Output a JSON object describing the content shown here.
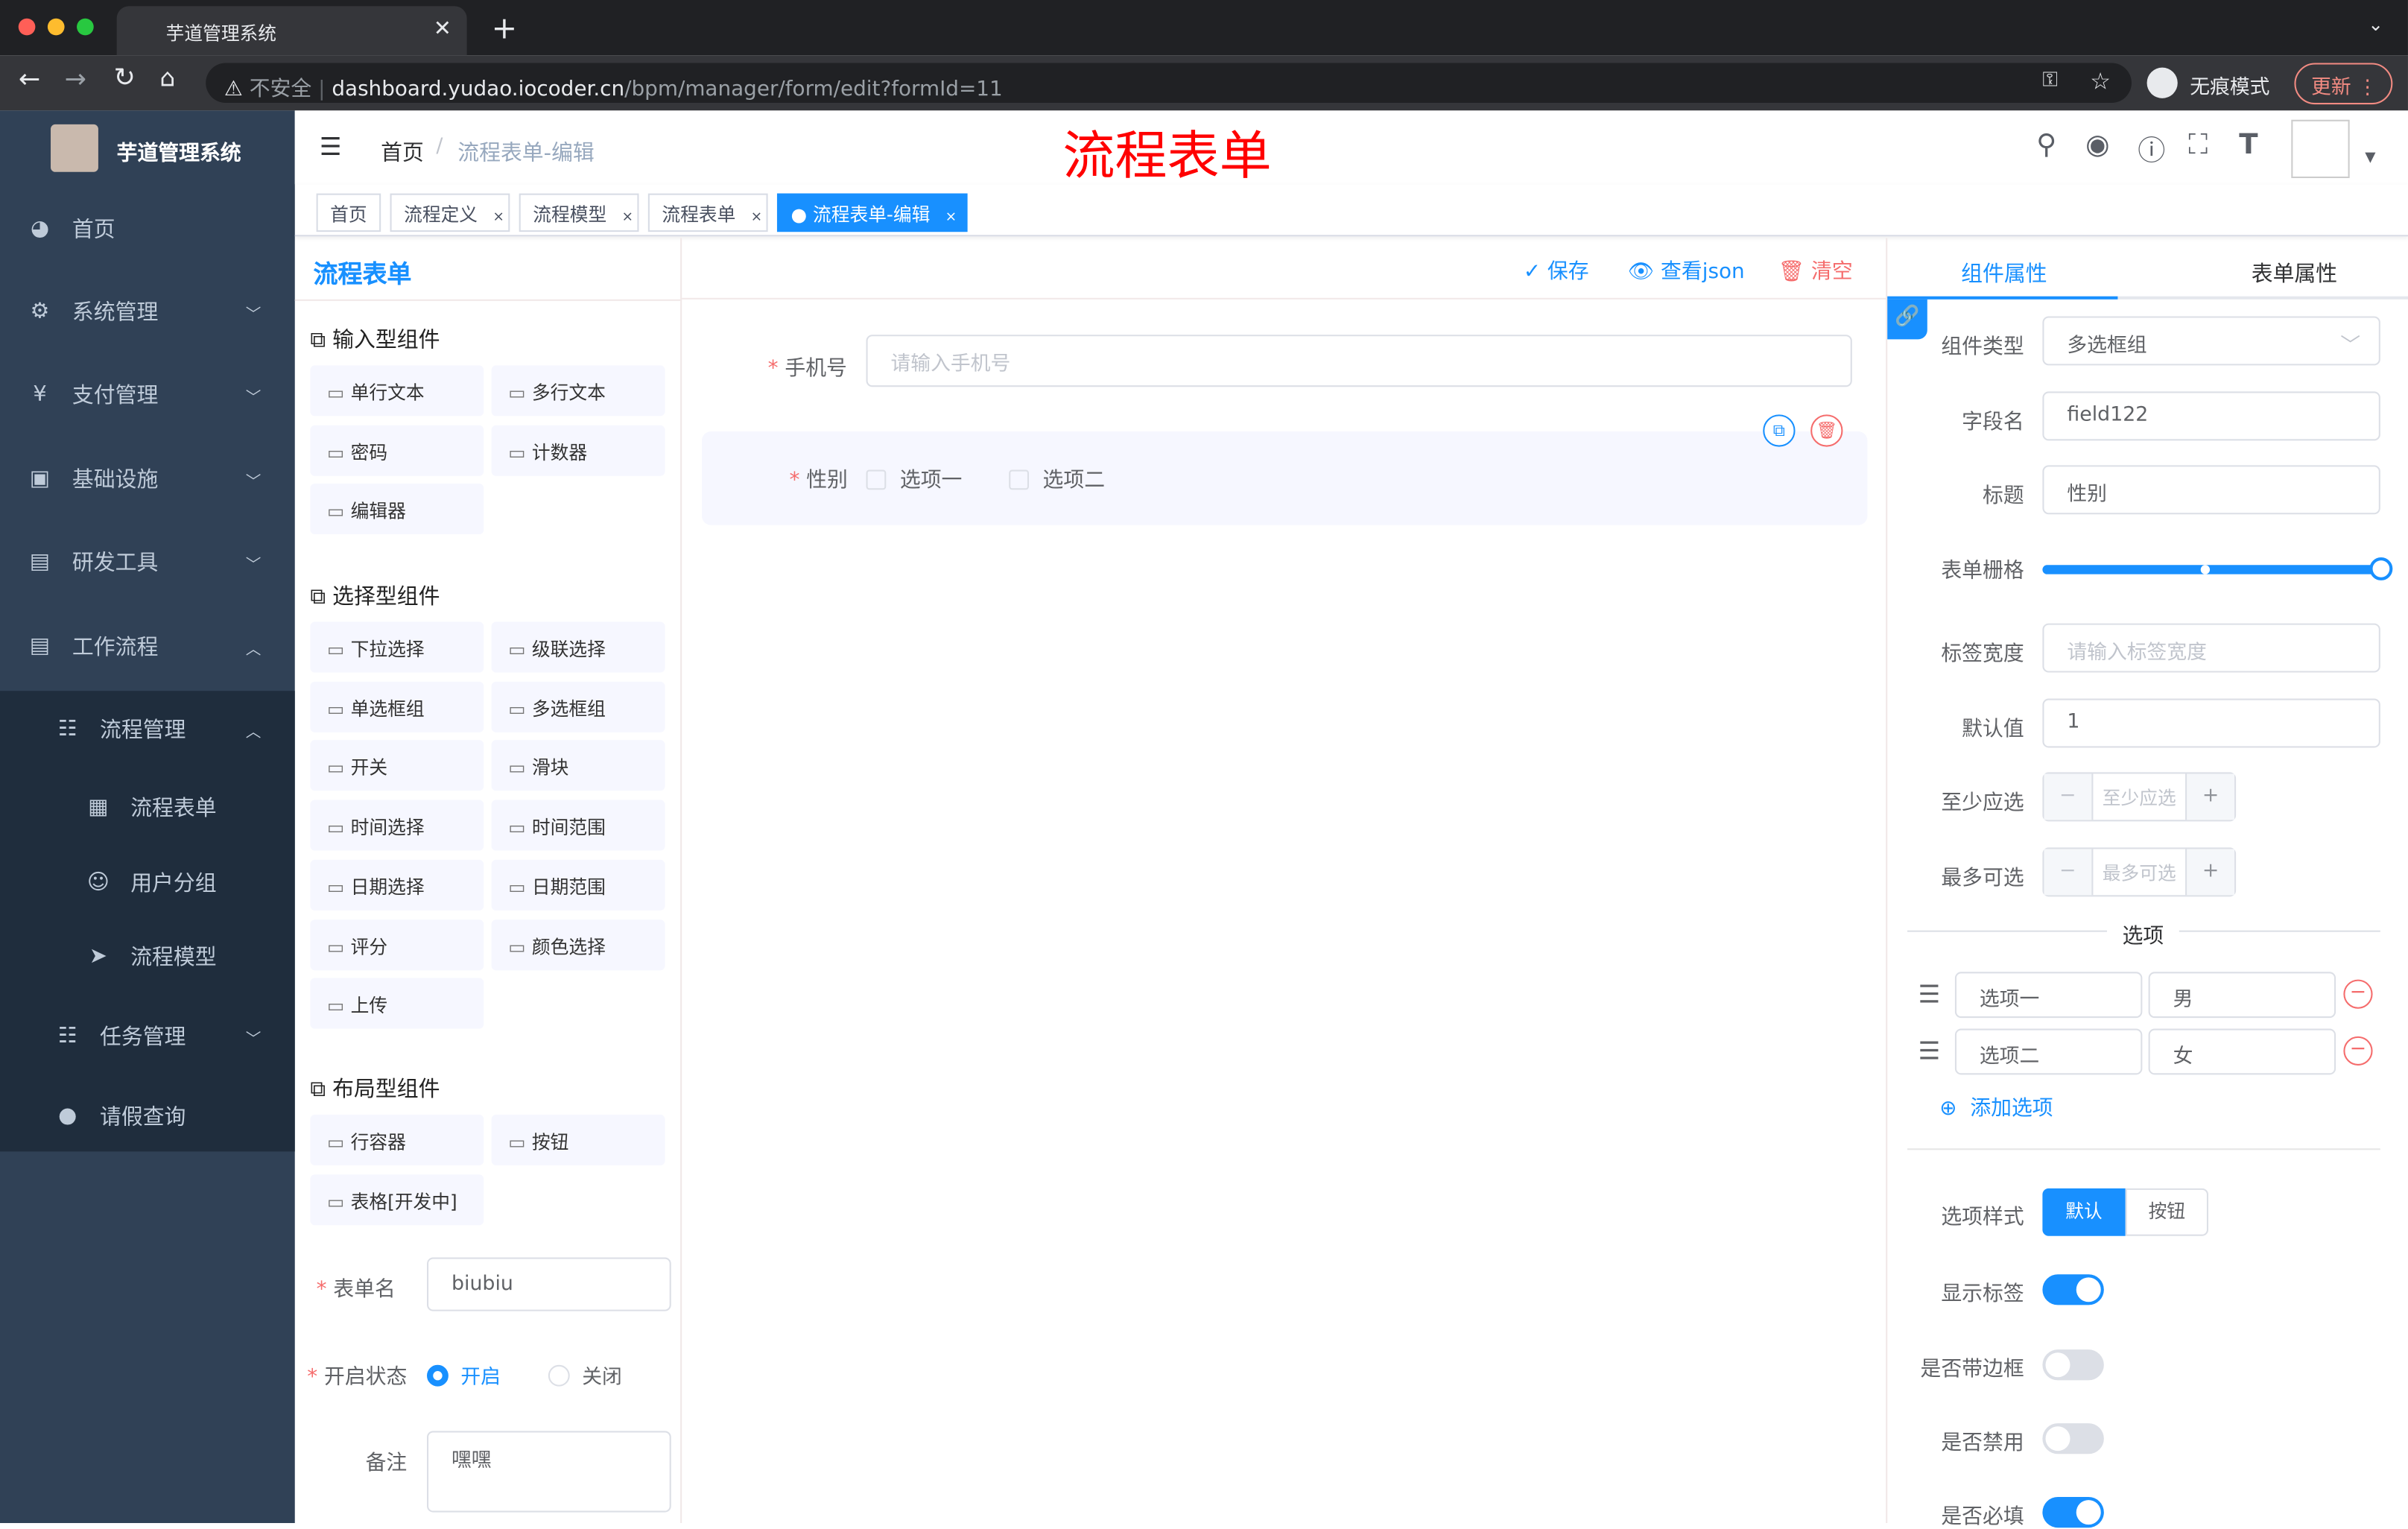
{
  "browser": {
    "tab_title": "芋道管理系统",
    "insecure": "不安全",
    "url_host": "dashboard.yudao.iocoder.cn",
    "url_path": "/bpm/manager/form/edit?formId=11",
    "incognito": "无痕模式",
    "update": "更新"
  },
  "sidebar": {
    "logo_title": "芋道管理系统",
    "items": [
      {
        "label": "首页",
        "icon": "dashboard-icon"
      },
      {
        "label": "系统管理",
        "icon": "gear-icon",
        "chevron": "down"
      },
      {
        "label": "支付管理",
        "icon": "yen-icon",
        "chevron": "down"
      },
      {
        "label": "基础设施",
        "icon": "monitor-icon",
        "chevron": "down"
      },
      {
        "label": "研发工具",
        "icon": "toolbox-icon",
        "chevron": "down"
      },
      {
        "label": "工作流程",
        "icon": "toolbox-icon",
        "chevron": "up"
      },
      {
        "label": "流程管理",
        "icon": "tree-icon",
        "chevron": "up"
      },
      {
        "label": "流程表单",
        "icon": "form-icon"
      },
      {
        "label": "用户分组",
        "icon": "group-icon"
      },
      {
        "label": "流程模型",
        "icon": "send-icon"
      },
      {
        "label": "任务管理",
        "icon": "tree-icon",
        "chevron": "down"
      },
      {
        "label": "请假查询",
        "icon": "user-icon"
      }
    ]
  },
  "header": {
    "breadcrumb_home": "首页",
    "breadcrumb_current": "流程表单-编辑",
    "overlay_title": "流程表单"
  },
  "tags": [
    {
      "label": "首页"
    },
    {
      "label": "流程定义"
    },
    {
      "label": "流程模型"
    },
    {
      "label": "流程表单"
    },
    {
      "label": "流程表单-编辑",
      "active": true
    }
  ],
  "left_panel": {
    "title": "流程表单",
    "sections": [
      {
        "title": "输入型组件",
        "items": [
          "单行文本",
          "多行文本",
          "密码",
          "计数器",
          "编辑器"
        ]
      },
      {
        "title": "选择型组件",
        "items": [
          "下拉选择",
          "级联选择",
          "单选框组",
          "多选框组",
          "开关",
          "滑块",
          "时间选择",
          "时间范围",
          "日期选择",
          "日期范围",
          "评分",
          "颜色选择",
          "上传"
        ]
      },
      {
        "title": "布局型组件",
        "items": [
          "行容器",
          "按钮",
          "表格[开发中]"
        ]
      }
    ],
    "form_name_label": "表单名",
    "form_name_value": "biubiu",
    "status_label": "开启状态",
    "status_on": "开启",
    "status_off": "关闭",
    "remark_label": "备注",
    "remark_value": "嘿嘿"
  },
  "toolbar": {
    "save": "保存",
    "view_json": "查看json",
    "clear": "清空"
  },
  "canvas": {
    "phone_label": "手机号",
    "phone_placeholder": "请输入手机号",
    "gender_label": "性别",
    "option1": "选项一",
    "option2": "选项二"
  },
  "right_panel": {
    "tab_component": "组件属性",
    "tab_form": "表单属性",
    "component_type_label": "组件类型",
    "component_type_value": "多选框组",
    "field_label": "字段名",
    "field_value": "field122",
    "title_label": "标题",
    "title_value": "性别",
    "grid_label": "表单栅格",
    "grid_value": 24,
    "grid_max": 24,
    "label_width_label": "标签宽度",
    "label_width_placeholder": "请输入标签宽度",
    "default_label": "默认值",
    "default_value": "1",
    "min_label": "至少应选",
    "min_placeholder": "至少应选",
    "max_label": "最多可选",
    "max_placeholder": "最多可选",
    "options_divider": "选项",
    "options": [
      {
        "label": "选项一",
        "value": "男"
      },
      {
        "label": "选项二",
        "value": "女"
      }
    ],
    "add_option": "添加选项",
    "style_label": "选项样式",
    "style_default": "默认",
    "style_button": "按钮",
    "show_label": "显示标签",
    "show_label_on": true,
    "border_label": "是否带边框",
    "border_on": false,
    "disabled_label": "是否禁用",
    "disabled_on": false,
    "required_label": "是否必填",
    "required_on": true
  },
  "colors": {
    "primary": "#1890ff",
    "sidebar": "#304156",
    "danger": "#f56c6c",
    "overlay_title": "#ff0000"
  }
}
